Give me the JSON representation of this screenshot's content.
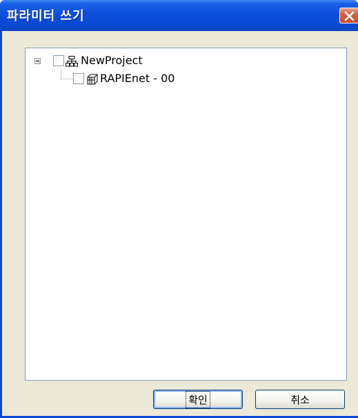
{
  "window": {
    "title": "파라미터 쓰기",
    "close_icon": "close-icon",
    "accent_color": "#0b47d6"
  },
  "tree": {
    "root": {
      "label": "NewProject",
      "expanded": true,
      "checked": false,
      "icon": "network-icon"
    },
    "children": [
      {
        "label": "RAPIEnet - 00",
        "checked": false,
        "icon": "module-icon"
      }
    ]
  },
  "buttons": {
    "ok_label": "확인",
    "cancel_label": "취소"
  }
}
